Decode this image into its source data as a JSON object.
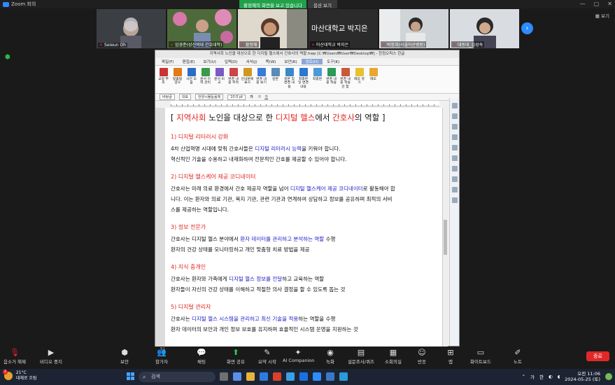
{
  "window": {
    "title": "Zoom 회의"
  },
  "share": {
    "status": "화면 공유 중",
    "viewing": "황정혜의 화면을 보고 있습니다",
    "options": "옵션 보기"
  },
  "participants": [
    {
      "name": "Seieun Oh"
    },
    {
      "name": "임경춘(성신여대 간호대학)"
    },
    {
      "name": "황정혜"
    },
    {
      "name": "마산대학교 박지은",
      "display_name": "마산대학교 박지은"
    },
    {
      "name": "박정희(서울아산병원)"
    },
    {
      "name": "대동대_김성숙"
    }
  ],
  "view_label": "보기",
  "hwp": {
    "title": "지역사회 노인을 대상으로 한 디지털 헬스에서 간호사의 역할.hwp [C:₩Users₩User₩Desktop₩] - 한컴오피스 한글",
    "menu": [
      "파일(F)",
      "편집(E)",
      "보기(U)",
      "입력(D)",
      "서식(J)",
      "쪽(W)",
      "보안(R)",
      "검토(H)",
      "도구(K)"
    ],
    "menu_active": "검토(H)",
    "ribbon": [
      "교정 부호",
      "맞춤법 검사",
      "사전 모음",
      "문서 이력 관리",
      "문서 비교",
      "변경 내용 추적",
      "안내문에 표시",
      "변경 내용 보기",
      "원본",
      "원본 및 변경 내용",
      "최종본 및 변경 내용",
      "최종본",
      "변경 내용 적용",
      "변경 내용 적용 안 함",
      "메모 넣기",
      "메모"
    ],
    "format": {
      "style": "바탕글",
      "lang": "대표",
      "font": "한양시뮬돋움체",
      "size": "10.0 pt"
    },
    "doc": {
      "title_open": "[ ",
      "title_red1": "지역사회",
      "title_mid": " 노인을 대상으로 한 ",
      "title_red2": "디지털 헬스",
      "title_mid2": "에서 ",
      "title_red3": "간호사",
      "title_end": "의 역할 ]",
      "sections": [
        {
          "title": "1) 디지털 리터러시 강화",
          "lines": [
            [
              "4차 산업혁명 시대에 맞춰 간호사들은 ",
              "디지털 리터러시 능력",
              "을 키워야 합니다."
            ],
            [
              "혁신적인 기술을 수용하고 내재화하여 전문적인 간호를 제공할 수 있어야 합니다.",
              "",
              ""
            ]
          ]
        },
        {
          "title": "2) 디지털 헬스케어 제공 코디네이터",
          "lines": [
            [
              "간호사는 미래 의료 환경에서 간호 제공자 역할을 넘어 ",
              "디지털 헬스케어 제공 코디네이터",
              "로 활동해야 합"
            ],
            [
              "니다. 이는 환자와 의료 기관, 복지 기관, 관련 기관과 연계하여 상담하고 정보를 공유하며 최적의 서비",
              "",
              ""
            ],
            [
              "스를 제공하는 역할입니다.",
              "",
              ""
            ]
          ]
        },
        {
          "title": "3) 정보 전문가",
          "lines": [
            [
              "간호사는 디지털 헬스 분야에서 ",
              "환자 데이터를 관리하고 분석하는 역할",
              " 수행"
            ],
            [
              "환자의 건강 상태를 모니터링하고 개인 맞춤형 치료 방법을 제공",
              "",
              ""
            ]
          ]
        },
        {
          "title": "4) 지식 중개인",
          "lines": [
            [
              "간호사는 환자와 가족에게 ",
              "디지털 헬스 정보를 전달",
              "하고 교육하는 역할"
            ],
            [
              "환자들이 자신의 건강 상태를 이해하고 적절한 의사 결정을 할 수 있도록 돕는 것",
              "",
              ""
            ]
          ]
        },
        {
          "title": "5) 디지털 관리자",
          "lines": [
            [
              "간호사는 ",
              "디지털 헬스 시스템을 관리하고 최신 기술을 적용",
              "하는 역할을 수행"
            ],
            [
              "환자 데이터의 보안과 개인 정보 보호를 유지하며 효율적인 시스템 운영을 지원하는 것",
              "",
              ""
            ]
          ]
        }
      ]
    }
  },
  "toolbar": [
    {
      "label": "음소거 해제",
      "icon": "mic-muted"
    },
    {
      "label": "비디오 중지",
      "icon": "video"
    },
    {
      "label": "보안",
      "icon": "shield"
    },
    {
      "label": "참가자",
      "icon": "people",
      "count": "51"
    },
    {
      "label": "채팅",
      "icon": "chat"
    },
    {
      "label": "화면 공유",
      "icon": "share"
    },
    {
      "label": "요약 시작",
      "icon": "summary"
    },
    {
      "label": "AI Companion",
      "icon": "ai"
    },
    {
      "label": "녹화",
      "icon": "record"
    },
    {
      "label": "설문조사/퀴즈",
      "icon": "poll"
    },
    {
      "label": "소회의실",
      "icon": "breakout"
    },
    {
      "label": "반응",
      "icon": "reaction"
    },
    {
      "label": "앱",
      "icon": "apps"
    },
    {
      "label": "화이트보드",
      "icon": "whiteboard"
    },
    {
      "label": "노트",
      "icon": "notes"
    }
  ],
  "end_label": "종료",
  "taskbar": {
    "weather_temp": "21°C",
    "weather_desc": "대체로 흐림",
    "badge": "1",
    "search": "검색",
    "ime1": "가",
    "ime2": "한",
    "time": "오전 11:06",
    "date": "2024-05-25 (토)"
  }
}
